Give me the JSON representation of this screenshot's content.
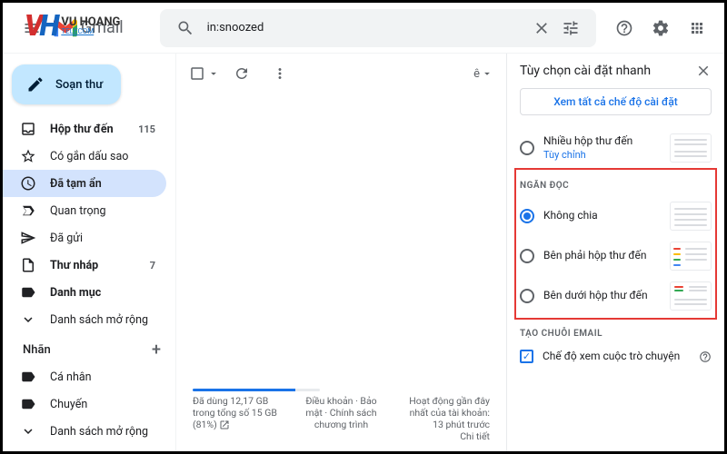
{
  "watermark": {
    "title": "VU HOANG",
    "sub": "TELECOM"
  },
  "header": {
    "logo_text": "Gmail",
    "search_value": "in:snoozed"
  },
  "compose_label": "Soạn thư",
  "nav": [
    {
      "icon": "inbox",
      "label": "Hộp thư đến",
      "count": "115",
      "bold": true
    },
    {
      "icon": "star",
      "label": "Có gắn dấu sao"
    },
    {
      "icon": "clock",
      "label": "Đã tạm ẩn",
      "active": true
    },
    {
      "icon": "send",
      "label": "Quan trọng"
    },
    {
      "icon": "sent",
      "label": "Đã gửi"
    },
    {
      "icon": "draft",
      "label": "Thư nháp",
      "count": "7",
      "bold": true
    },
    {
      "icon": "label",
      "label": "Danh mục",
      "bold": true
    },
    {
      "icon": "expand",
      "label": "Danh sách mở rộng"
    }
  ],
  "labels_header": "Nhãn",
  "labels": [
    {
      "label": "Cá nhân"
    },
    {
      "label": "Chuyến"
    },
    {
      "label": "Danh sách mở rộng",
      "icon": "expand"
    }
  ],
  "footer": {
    "storage_text": "Đã dùng 12,17 GB trong tổng số 15 GB (81%)",
    "terms": "Điều khoản · Bảo mật · Chính sách chương trình",
    "activity_line1": "Hoạt động gần đây nhất của tài khoản: 13 phút trước",
    "activity_line2": "Chi tiết"
  },
  "settings": {
    "title": "Tùy chọn cài đặt nhanh",
    "see_all": "Xem tất cả chế độ cài đặt",
    "multi_inbox_label": "Nhiều hộp thư đến",
    "multi_inbox_sub": "Tùy chỉnh",
    "reading_pane_title": "Ngăn đọc",
    "reading_options": [
      {
        "label": "Không chia",
        "selected": true
      },
      {
        "label": "Bên phải hộp thư đến"
      },
      {
        "label": "Bên dưới hộp thư đến"
      }
    ],
    "thread_title": "Tạo chuỗi email",
    "thread_option": "Chế độ xem cuộc trò chuyện"
  }
}
